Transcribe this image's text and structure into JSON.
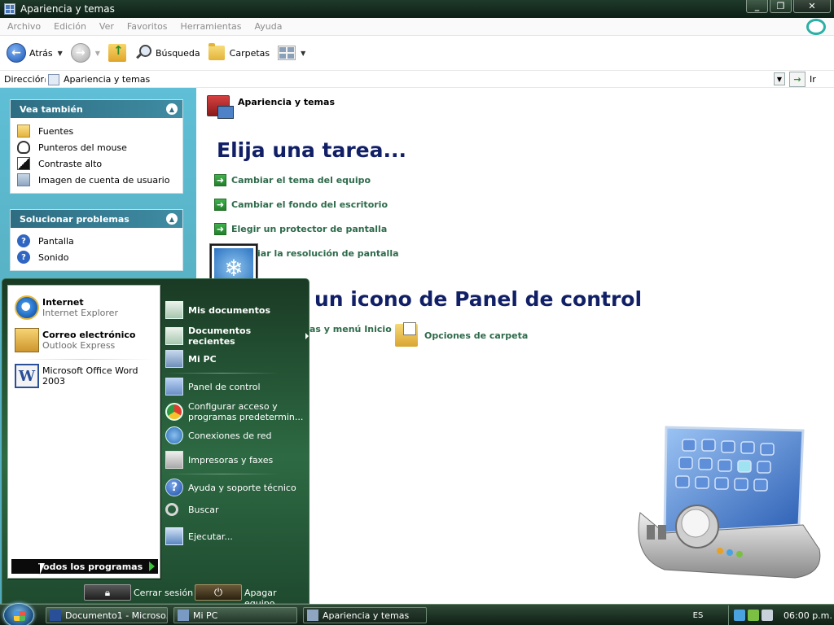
{
  "window": {
    "title": "Apariencia y temas",
    "minimize": "_",
    "maximize": "❐",
    "close": "✕"
  },
  "menu": [
    "Archivo",
    "Edición",
    "Ver",
    "Favoritos",
    "Herramientas",
    "Ayuda"
  ],
  "toolbar": {
    "back_label": "Atrás",
    "search_label": "Búsqueda",
    "folders_label": "Carpetas"
  },
  "address": {
    "label": "Dirección",
    "value": "Apariencia y temas",
    "go_label": "Ir"
  },
  "sidebar": {
    "see_also": {
      "title": "Vea también",
      "items": [
        "Fuentes",
        "Punteros del mouse",
        "Contraste alto",
        "Imagen de cuenta de usuario"
      ]
    },
    "troubleshoot": {
      "title": "Solucionar problemas",
      "items": [
        "Pantalla",
        "Sonido"
      ]
    }
  },
  "content": {
    "breadcrumb": "Apariencia y temas",
    "heading_task": "Elija una tarea...",
    "tasks": [
      "Cambiar el tema del equipo",
      "Cambiar el fondo del escritorio",
      "Elegir un protector de pantalla",
      "iar la resolución de pantalla"
    ],
    "heading_icon": "un icono de Panel de control",
    "icons": [
      "as y menú Inicio",
      "Opciones de carpeta"
    ]
  },
  "start_menu": {
    "pinned": [
      {
        "title": "Internet",
        "sub": "Internet Explorer"
      },
      {
        "title": "Correo electrónico",
        "sub": "Outlook Express"
      }
    ],
    "recent": [
      "Microsoft Office Word 2003"
    ],
    "all_programs": "Todos los programas",
    "right": [
      "Mis documentos",
      "Documentos recientes",
      "Mi PC",
      "Panel de control",
      "Configurar acceso y",
      "programas predetermin...",
      "Conexiones de red",
      "Impresoras y faxes",
      "Ayuda y soporte técnico",
      "Buscar",
      "Ejecutar..."
    ],
    "logoff": "Cerrar sesión",
    "shutdown": "Apagar equipo"
  },
  "taskbar": {
    "buttons": [
      "Documento1 - Microso...",
      "Mi PC",
      "Apariencia y temas"
    ],
    "language": "ES",
    "clock": "06:00 p.m."
  }
}
